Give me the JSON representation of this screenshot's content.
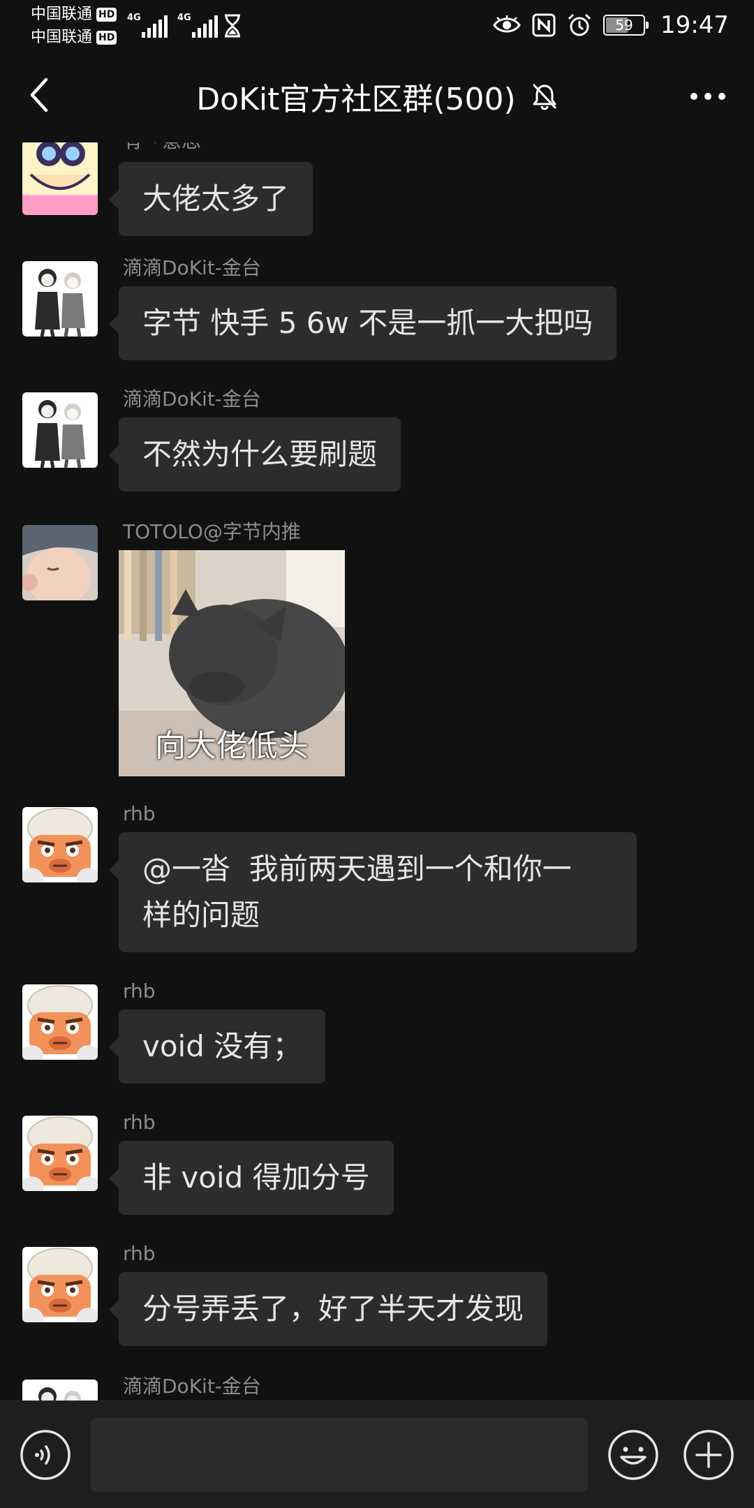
{
  "status_bar": {
    "carrier_1": "中国联通",
    "carrier_2": "中国联通",
    "hd_badge": "HD",
    "network_1": "4G",
    "network_2": "4G",
    "battery_level": "59",
    "battery_fraction": 0.59,
    "time": "19:47",
    "icons": [
      "eye-icon",
      "nfc-icon",
      "alarm-icon",
      "hourglass-icon"
    ]
  },
  "nav": {
    "title": "DoKit官方社区群(500)",
    "muted_icon": "bell-off-icon",
    "back_icon": "chevron-left-icon",
    "more_icon": "more-dots-icon"
  },
  "messages": [
    {
      "sender": "有丶意思",
      "text": "大佬太多了",
      "avatar": "avatar-binoculars"
    },
    {
      "sender": "滴滴DoKit-金台",
      "text": "字节 快手 5 6w 不是一抓一大把吗",
      "avatar": "avatar-sketch-duo"
    },
    {
      "sender": "滴滴DoKit-金台",
      "text": "不然为什么要刷题",
      "avatar": "avatar-sketch-duo"
    },
    {
      "sender": "TOTOLO@字节内推",
      "image_caption": "向大佬低头",
      "avatar": "avatar-baby"
    },
    {
      "sender": "rhb",
      "text_line1": "@一沓  我前两天遇到一个和你一",
      "text_line2": "样的问题",
      "avatar": "avatar-cartoon"
    },
    {
      "sender": "rhb",
      "text": "void 没有；",
      "avatar": "avatar-cartoon"
    },
    {
      "sender": "rhb",
      "text": "非 void 得加分号",
      "avatar": "avatar-cartoon"
    },
    {
      "sender": "rhb",
      "text": "分号弄丢了，好了半天才发现",
      "avatar": "avatar-cartoon"
    },
    {
      "sender": "滴滴DoKit-金台",
      "avatar": "avatar-sketch-duo"
    }
  ],
  "input_bar": {
    "placeholder": "",
    "value": "",
    "voice_icon": "voice-icon",
    "emoji_icon": "emoji-icon",
    "plus_icon": "plus-icon"
  }
}
